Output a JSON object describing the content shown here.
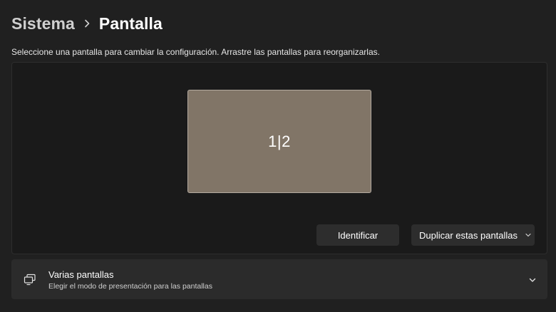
{
  "breadcrumb": {
    "parent": "Sistema",
    "current": "Pantalla"
  },
  "instructions": "Seleccione una pantalla para cambiar la configuración. Arrastre las pantallas para reorganizarlas.",
  "display_arrangement": {
    "monitor_label": "1|2",
    "identify_button": "Identificar",
    "mode_select": {
      "selected": "Duplicar estas pantallas"
    }
  },
  "multiple_displays": {
    "title": "Varias pantallas",
    "description": "Elegir el modo de presentación para las pantallas",
    "icon": "multiple-monitors-icon"
  },
  "colors": {
    "background": "#202020",
    "panel": "#1a1a1a",
    "monitor": "#817567",
    "button": "#2d2d2d",
    "card": "#2b2b2b"
  }
}
